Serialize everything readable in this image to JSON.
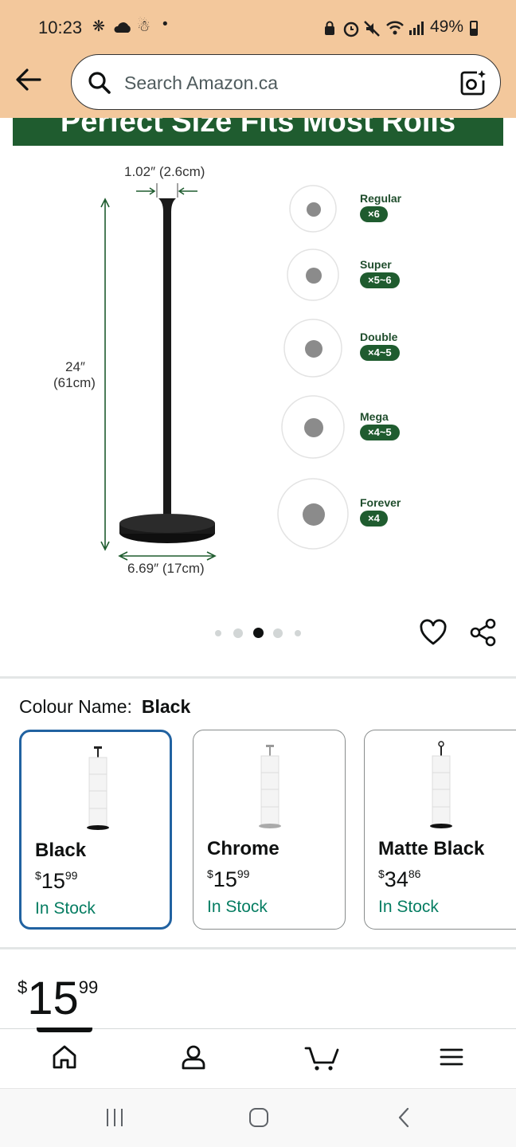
{
  "status_bar": {
    "time": "10:23",
    "battery": "49%"
  },
  "header": {
    "search_placeholder": "Search Amazon.ca"
  },
  "product_image": {
    "banner_text": "Perfect Size Fits Most Rolls",
    "top_width": "1.02″ (2.6cm)",
    "height_label": "24″",
    "height_metric": "(61cm)",
    "base_width": "6.69″ (17cm)",
    "rolls": [
      {
        "name": "Regular",
        "count": "×6"
      },
      {
        "name": "Super",
        "count": "×5~6"
      },
      {
        "name": "Double",
        "count": "×4~5"
      },
      {
        "name": "Mega",
        "count": "×4~5"
      },
      {
        "name": "Forever",
        "count": "×4"
      }
    ],
    "carousel": {
      "total": 5,
      "active_index": 2
    }
  },
  "colour": {
    "label": "Colour Name:",
    "selected": "Black",
    "options": [
      {
        "name": "Black",
        "currency": "$",
        "whole": "15",
        "fraction": "99",
        "stock": "In Stock",
        "selected": true
      },
      {
        "name": "Chrome",
        "currency": "$",
        "whole": "15",
        "fraction": "99",
        "stock": "In Stock",
        "selected": false
      },
      {
        "name": "Matte Black",
        "currency": "$",
        "whole": "34",
        "fraction": "86",
        "stock": "In Stock",
        "selected": false
      }
    ]
  },
  "price": {
    "currency": "$",
    "whole": "15",
    "fraction": "99"
  },
  "bottom_nav": {
    "cart_count": "0",
    "items": [
      "home-icon",
      "account-icon",
      "cart-icon",
      "menu-icon"
    ]
  },
  "colors": {
    "header_bg": "#f3c89c",
    "banner_green": "#1f5c2f",
    "stock_green": "#067d62",
    "selected_border": "#2162a1"
  }
}
